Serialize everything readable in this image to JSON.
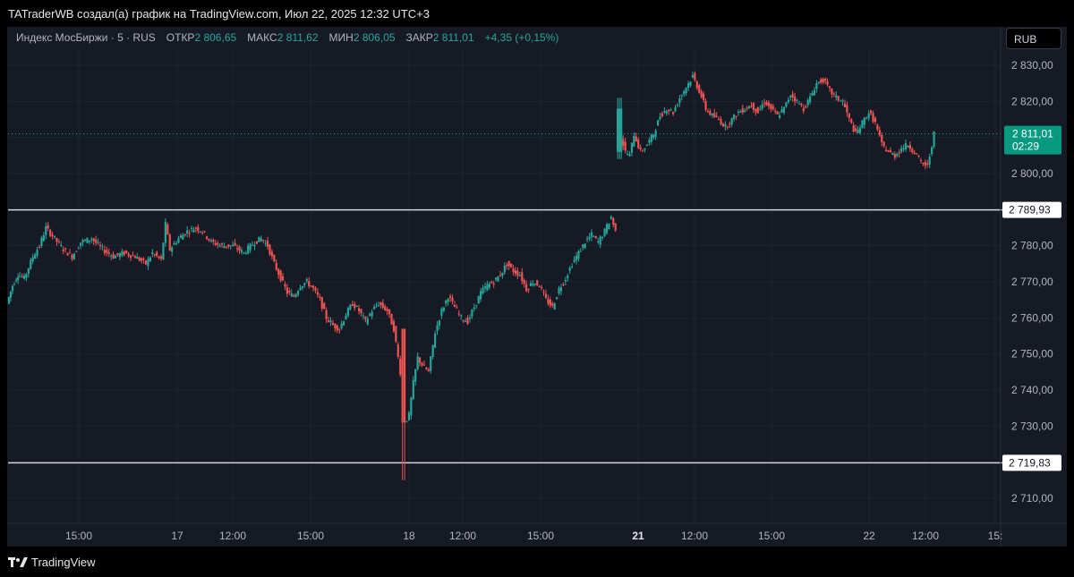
{
  "header": {
    "title": "TATraderWB создал(а) график на TradingView.com, Июл 22, 2025 12:32 UTC+3"
  },
  "legend": {
    "symbol": "Индекс МосБиржи · 5 · RUS",
    "open_label": "ОТКР",
    "open_value": "2 806,65",
    "high_label": "МАКС",
    "high_value": "2 811,62",
    "low_label": "МИН",
    "low_value": "2 806,05",
    "close_label": "ЗАКР",
    "close_value": "2 811,01",
    "change": "+4,35 (+0,15%)"
  },
  "currency_button": "RUB",
  "price_badge": {
    "price": "2 811,01",
    "countdown": "02:29"
  },
  "horizontal_levels": [
    {
      "value": 2789.93,
      "label": "2 789,93"
    },
    {
      "value": 2719.83,
      "label": "2 719,83"
    }
  ],
  "footer": {
    "brand": "TradingView"
  },
  "colors": {
    "up": "#26a69a",
    "down": "#ef5350",
    "background": "#161a25",
    "level_line": "#d1d4dc"
  },
  "chart_data": {
    "type": "candlestick",
    "title": "",
    "ylim": [
      2705,
      2835
    ],
    "y_ticks": [
      "2 710,00",
      "2 720,00",
      "2 730,00",
      "2 740,00",
      "2 750,00",
      "2 760,00",
      "2 770,00",
      "2 780,00",
      "2 790,00",
      "2 800,00",
      "2 810,00",
      "2 820,00",
      "2 830,00"
    ],
    "y_tick_values": [
      2710,
      2720,
      2730,
      2740,
      2750,
      2760,
      2770,
      2780,
      2790,
      2800,
      2810,
      2820,
      2830
    ],
    "x_ticks": [
      "15:00",
      "17",
      "12:00",
      "15:00",
      "18",
      "12:00",
      "15:00",
      "21",
      "12:00",
      "15:00",
      "22",
      "12:00",
      "15:"
    ],
    "bold_x_ticks": [
      "21"
    ],
    "last_price": 2811.01,
    "price_path": [
      {
        "t": 0,
        "p": 2764
      },
      {
        "t": 5,
        "p": 2769
      },
      {
        "t": 10,
        "p": 2772
      },
      {
        "t": 16,
        "p": 2771
      },
      {
        "t": 24,
        "p": 2777
      },
      {
        "t": 30,
        "p": 2780
      },
      {
        "t": 36,
        "p": 2785
      },
      {
        "t": 44,
        "p": 2782
      },
      {
        "t": 52,
        "p": 2779
      },
      {
        "t": 60,
        "p": 2777
      },
      {
        "t": 68,
        "p": 2781
      },
      {
        "t": 78,
        "p": 2782
      },
      {
        "t": 88,
        "p": 2779
      },
      {
        "t": 98,
        "p": 2777
      },
      {
        "t": 108,
        "p": 2778
      },
      {
        "t": 118,
        "p": 2777
      },
      {
        "t": 128,
        "p": 2775
      },
      {
        "t": 134,
        "p": 2778
      },
      {
        "t": 142,
        "p": 2776
      },
      {
        "t": 146,
        "p": 2786
      },
      {
        "t": 150,
        "p": 2779
      },
      {
        "t": 158,
        "p": 2782
      },
      {
        "t": 166,
        "p": 2784
      },
      {
        "t": 174,
        "p": 2785
      },
      {
        "t": 180,
        "p": 2784
      },
      {
        "t": 188,
        "p": 2781
      },
      {
        "t": 198,
        "p": 2780
      },
      {
        "t": 208,
        "p": 2780
      },
      {
        "t": 218,
        "p": 2778
      },
      {
        "t": 228,
        "p": 2781
      },
      {
        "t": 234,
        "p": 2782
      },
      {
        "t": 240,
        "p": 2780
      },
      {
        "t": 246,
        "p": 2775
      },
      {
        "t": 252,
        "p": 2771
      },
      {
        "t": 258,
        "p": 2767
      },
      {
        "t": 264,
        "p": 2766
      },
      {
        "t": 270,
        "p": 2769
      },
      {
        "t": 276,
        "p": 2770
      },
      {
        "t": 282,
        "p": 2768
      },
      {
        "t": 288,
        "p": 2765
      },
      {
        "t": 294,
        "p": 2760
      },
      {
        "t": 300,
        "p": 2758
      },
      {
        "t": 306,
        "p": 2757
      },
      {
        "t": 312,
        "p": 2761
      },
      {
        "t": 318,
        "p": 2764
      },
      {
        "t": 324,
        "p": 2762
      },
      {
        "t": 330,
        "p": 2759
      },
      {
        "t": 336,
        "p": 2762
      },
      {
        "t": 342,
        "p": 2764
      },
      {
        "t": 350,
        "p": 2762
      },
      {
        "t": 356,
        "p": 2757
      },
      {
        "t": 362,
        "p": 2745
      },
      {
        "t": 366,
        "p": 2731
      },
      {
        "t": 370,
        "p": 2733
      },
      {
        "t": 374,
        "p": 2742
      },
      {
        "t": 378,
        "p": 2749
      },
      {
        "t": 382,
        "p": 2747
      },
      {
        "t": 388,
        "p": 2745
      },
      {
        "t": 394,
        "p": 2756
      },
      {
        "t": 400,
        "p": 2762
      },
      {
        "t": 406,
        "p": 2766
      },
      {
        "t": 412,
        "p": 2763
      },
      {
        "t": 418,
        "p": 2760
      },
      {
        "t": 424,
        "p": 2759
      },
      {
        "t": 430,
        "p": 2763
      },
      {
        "t": 436,
        "p": 2767
      },
      {
        "t": 442,
        "p": 2769
      },
      {
        "t": 448,
        "p": 2770
      },
      {
        "t": 454,
        "p": 2772
      },
      {
        "t": 460,
        "p": 2775
      },
      {
        "t": 466,
        "p": 2773
      },
      {
        "t": 472,
        "p": 2772
      },
      {
        "t": 478,
        "p": 2768
      },
      {
        "t": 484,
        "p": 2770
      },
      {
        "t": 490,
        "p": 2769
      },
      {
        "t": 496,
        "p": 2765
      },
      {
        "t": 502,
        "p": 2763
      },
      {
        "t": 508,
        "p": 2768
      },
      {
        "t": 514,
        "p": 2771
      },
      {
        "t": 520,
        "p": 2775
      },
      {
        "t": 526,
        "p": 2778
      },
      {
        "t": 532,
        "p": 2781
      },
      {
        "t": 538,
        "p": 2783
      },
      {
        "t": 544,
        "p": 2781
      },
      {
        "t": 550,
        "p": 2784
      },
      {
        "t": 556,
        "p": 2788
      },
      {
        "t": 560,
        "p": 2784
      },
      {
        "t": 565,
        "p": 2810
      },
      {
        "t": 569,
        "p": 2806
      },
      {
        "t": 573,
        "p": 2805
      },
      {
        "t": 577,
        "p": 2811
      },
      {
        "t": 583,
        "p": 2806
      },
      {
        "t": 589,
        "p": 2808
      },
      {
        "t": 595,
        "p": 2811
      },
      {
        "t": 601,
        "p": 2816
      },
      {
        "t": 607,
        "p": 2818
      },
      {
        "t": 613,
        "p": 2817
      },
      {
        "t": 619,
        "p": 2821
      },
      {
        "t": 625,
        "p": 2824
      },
      {
        "t": 631,
        "p": 2827
      },
      {
        "t": 637,
        "p": 2823
      },
      {
        "t": 643,
        "p": 2818
      },
      {
        "t": 649,
        "p": 2816
      },
      {
        "t": 655,
        "p": 2815
      },
      {
        "t": 661,
        "p": 2813
      },
      {
        "t": 667,
        "p": 2815
      },
      {
        "t": 673,
        "p": 2817
      },
      {
        "t": 679,
        "p": 2818
      },
      {
        "t": 685,
        "p": 2819
      },
      {
        "t": 691,
        "p": 2817
      },
      {
        "t": 697,
        "p": 2820
      },
      {
        "t": 703,
        "p": 2818
      },
      {
        "t": 709,
        "p": 2816
      },
      {
        "t": 715,
        "p": 2818
      },
      {
        "t": 721,
        "p": 2822
      },
      {
        "t": 727,
        "p": 2820
      },
      {
        "t": 733,
        "p": 2818
      },
      {
        "t": 739,
        "p": 2821
      },
      {
        "t": 745,
        "p": 2825
      },
      {
        "t": 751,
        "p": 2826
      },
      {
        "t": 757,
        "p": 2823
      },
      {
        "t": 763,
        "p": 2821
      },
      {
        "t": 769,
        "p": 2820
      },
      {
        "t": 775,
        "p": 2815
      },
      {
        "t": 781,
        "p": 2811
      },
      {
        "t": 787,
        "p": 2814
      },
      {
        "t": 793,
        "p": 2817
      },
      {
        "t": 799,
        "p": 2814
      },
      {
        "t": 805,
        "p": 2808
      },
      {
        "t": 811,
        "p": 2806
      },
      {
        "t": 817,
        "p": 2805
      },
      {
        "t": 823,
        "p": 2807
      },
      {
        "t": 829,
        "p": 2808
      },
      {
        "t": 835,
        "p": 2806
      },
      {
        "t": 841,
        "p": 2803
      },
      {
        "t": 847,
        "p": 2802
      },
      {
        "t": 853,
        "p": 2811
      }
    ]
  }
}
